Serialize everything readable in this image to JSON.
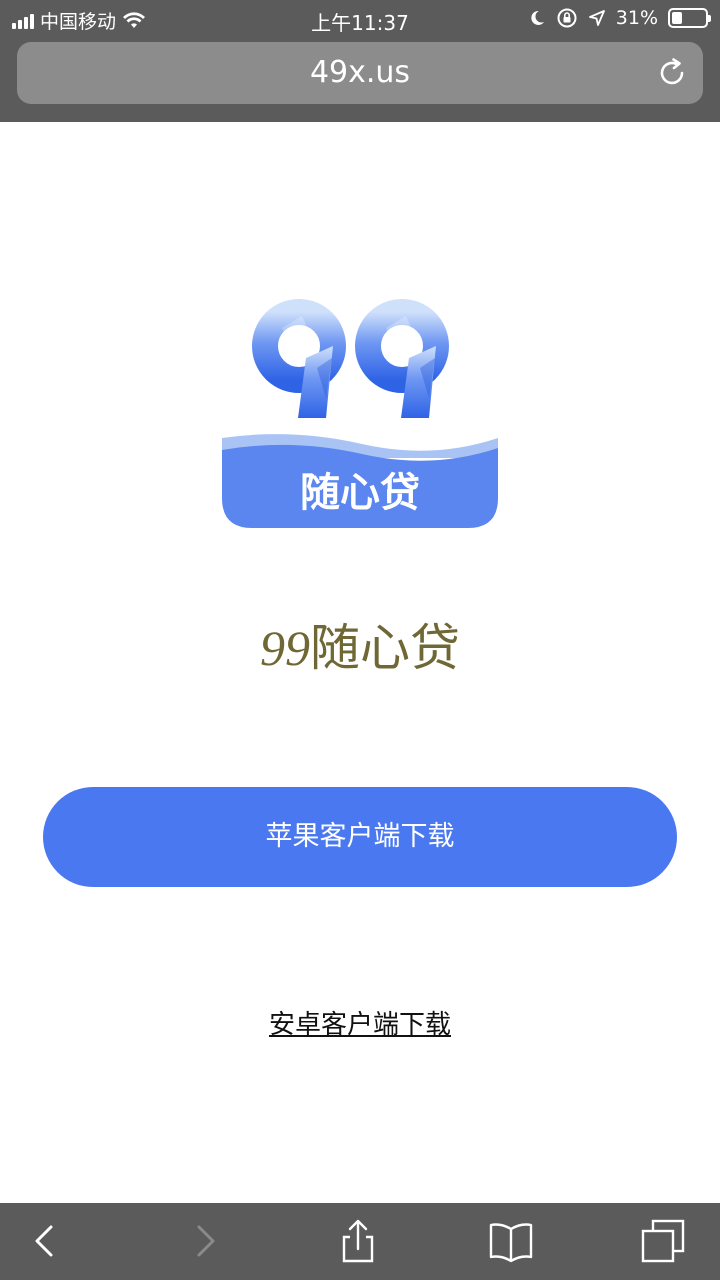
{
  "status_bar": {
    "carrier": "中国移动",
    "time": "上午11:37",
    "battery_percent": "31%",
    "battery_level": 0.31,
    "icons": [
      "signal-icon",
      "wifi-icon",
      "moon-icon",
      "orientation-lock-icon",
      "location-arrow-icon",
      "battery-icon"
    ]
  },
  "browser": {
    "url": "49x.us",
    "reload_icon": "reload-icon"
  },
  "logo": {
    "number": "99",
    "text": "随心贷",
    "colors": {
      "primary": "#4a78f0",
      "light": "#a9c4f4",
      "banner": "#5b86ef"
    }
  },
  "app_title": {
    "number": "99",
    "name": "随心贷",
    "color": "#6f6734"
  },
  "buttons": {
    "ios_download": "苹果客户端下载",
    "android_download": "安卓客户端下载",
    "accent": "#4a78f0"
  },
  "toolbar": {
    "items": [
      "back-icon",
      "forward-icon",
      "share-icon",
      "bookmarks-icon",
      "tabs-icon"
    ]
  }
}
